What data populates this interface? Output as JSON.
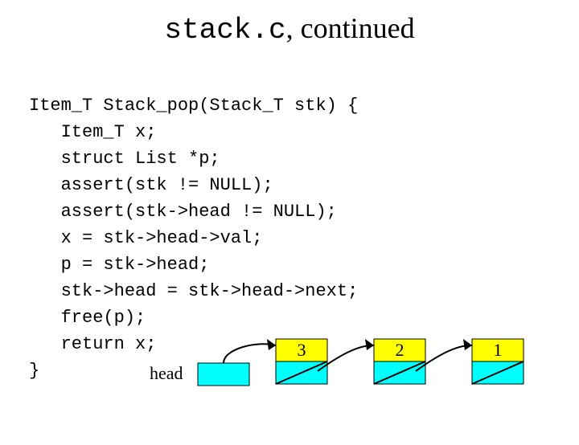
{
  "title": {
    "mono_part": "stack.c",
    "rest_part": ", continued"
  },
  "code": {
    "l0": "Item_T Stack_pop(Stack_T stk) {",
    "l1": "   Item_T x;",
    "l2": "   struct List *p;",
    "l3": "   assert(stk != NULL);",
    "l4": "   assert(stk->head != NULL);",
    "l5": "   x = stk->head->val;",
    "l6": "   p = stk->head;",
    "l7": "   stk->head = stk->head->next;",
    "l8": "   free(p);",
    "l9": "   return x;",
    "l10": "}"
  },
  "diagram": {
    "head_label": "head",
    "node1_val": "3",
    "node2_val": "2",
    "node3_val": "1"
  }
}
